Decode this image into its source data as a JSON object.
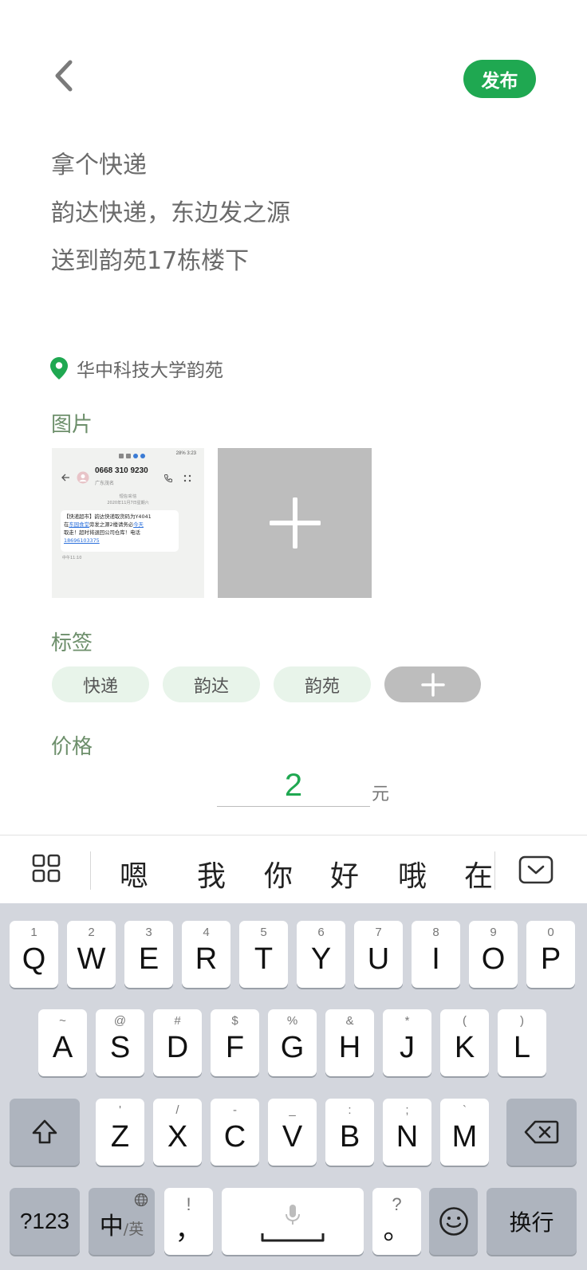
{
  "header": {
    "publish_label": "发布"
  },
  "description": {
    "lines": [
      "拿个快递",
      "韵达快递，东边发之源",
      "送到韵苑17栋楼下"
    ]
  },
  "location": {
    "text": "华中科技大学韵苑"
  },
  "photos": {
    "label": "图片",
    "thumb": {
      "status_bar": "28% 3:23",
      "phone": "0668 310 9230",
      "region": "广东茂名",
      "meta_line1": "短信/彩信",
      "meta_line2": "2020年11月7日星期六",
      "message_line1": "【快递超市】韵达快递取货码为Y4041",
      "message_line2a": "在",
      "message_link1": "东园食堂",
      "message_line2b": "旁发之源2楼请务必",
      "message_link2": "今天",
      "message_line3": "取走！超时将退回公司仓库！电话",
      "message_link3": "18696103375",
      "time": "中午11:10"
    }
  },
  "tags": {
    "label": "标签",
    "items": [
      "快递",
      "韵达",
      "韵苑"
    ]
  },
  "price": {
    "label": "价格",
    "value": "2",
    "unit": "元"
  },
  "keyboard": {
    "candidates": [
      "嗯",
      "我",
      "你",
      "好",
      "哦",
      "在"
    ],
    "row1": [
      {
        "hint": "1",
        "key": "Q"
      },
      {
        "hint": "2",
        "key": "W"
      },
      {
        "hint": "3",
        "key": "E"
      },
      {
        "hint": "4",
        "key": "R"
      },
      {
        "hint": "5",
        "key": "T"
      },
      {
        "hint": "6",
        "key": "Y"
      },
      {
        "hint": "7",
        "key": "U"
      },
      {
        "hint": "8",
        "key": "I"
      },
      {
        "hint": "9",
        "key": "O"
      },
      {
        "hint": "0",
        "key": "P"
      }
    ],
    "row2": [
      {
        "hint": "~",
        "key": "A"
      },
      {
        "hint": "@",
        "key": "S"
      },
      {
        "hint": "#",
        "key": "D"
      },
      {
        "hint": "$",
        "key": "F"
      },
      {
        "hint": "%",
        "key": "G"
      },
      {
        "hint": "&",
        "key": "H"
      },
      {
        "hint": "*",
        "key": "J"
      },
      {
        "hint": "(",
        "key": "K"
      },
      {
        "hint": ")",
        "key": "L"
      }
    ],
    "row3": [
      {
        "hint": "'",
        "key": "Z"
      },
      {
        "hint": "/",
        "key": "X"
      },
      {
        "hint": "-",
        "key": "C"
      },
      {
        "hint": "_",
        "key": "V"
      },
      {
        "hint": ":",
        "key": "B"
      },
      {
        "hint": ";",
        "key": "N"
      },
      {
        "hint": "`",
        "key": "M"
      }
    ],
    "num_label": "?123",
    "lang_main": "中",
    "lang_sub": "/英",
    "comma_hint": "!",
    "comma_key": "，",
    "period_hint": "?",
    "period_key": "。",
    "enter_label": "换行"
  }
}
